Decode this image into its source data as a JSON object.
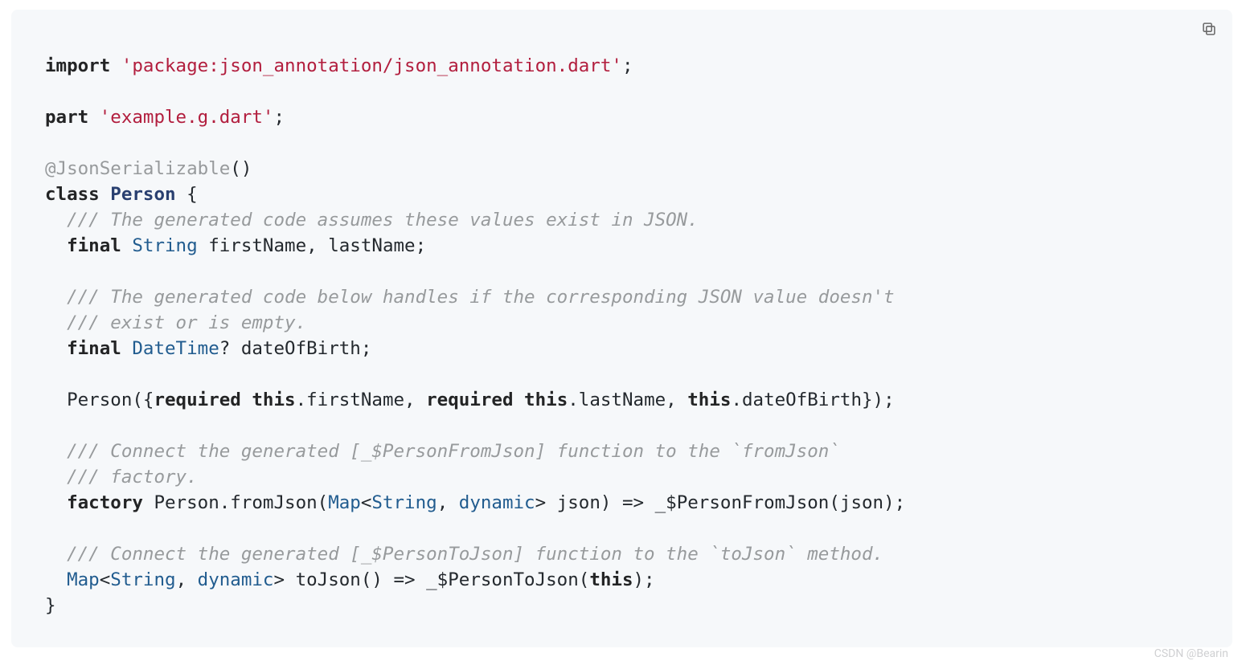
{
  "watermark": "CSDN @Bearin",
  "tokens": [
    [
      [
        "import ",
        "s-kw"
      ],
      [
        "'package:json_annotation/json_annotation.dart'",
        "s-str"
      ],
      [
        ";",
        ""
      ]
    ],
    [],
    [
      [
        "part ",
        "s-kw"
      ],
      [
        "'example.g.dart'",
        "s-str"
      ],
      [
        ";",
        ""
      ]
    ],
    [],
    [
      [
        "@JsonSerializable",
        "s-ann"
      ],
      [
        "()",
        ""
      ]
    ],
    [
      [
        "class ",
        "s-kw"
      ],
      [
        "Person",
        "s-cls"
      ],
      [
        " {",
        ""
      ]
    ],
    [
      [
        "  ",
        ""
      ],
      [
        "/// The generated code assumes these values exist in JSON.",
        "s-cmt"
      ]
    ],
    [
      [
        "  ",
        ""
      ],
      [
        "final ",
        "s-kw"
      ],
      [
        "String",
        "s-type"
      ],
      [
        " firstName, lastName;",
        ""
      ]
    ],
    [],
    [
      [
        "  ",
        ""
      ],
      [
        "/// The generated code below handles if the corresponding JSON value doesn't",
        "s-cmt"
      ]
    ],
    [
      [
        "  ",
        ""
      ],
      [
        "/// exist or is empty.",
        "s-cmt"
      ]
    ],
    [
      [
        "  ",
        ""
      ],
      [
        "final ",
        "s-kw"
      ],
      [
        "DateTime",
        "s-type"
      ],
      [
        "? dateOfBirth;",
        ""
      ]
    ],
    [],
    [
      [
        "  Person({",
        ""
      ],
      [
        "required this",
        "s-kw"
      ],
      [
        ".firstName, ",
        ""
      ],
      [
        "required this",
        "s-kw"
      ],
      [
        ".lastName, ",
        ""
      ],
      [
        "this",
        "s-kw"
      ],
      [
        ".dateOfBirth});",
        ""
      ]
    ],
    [],
    [
      [
        "  ",
        ""
      ],
      [
        "/// Connect the generated [_$PersonFromJson] function to the `fromJson`",
        "s-cmt"
      ]
    ],
    [
      [
        "  ",
        ""
      ],
      [
        "/// factory.",
        "s-cmt"
      ]
    ],
    [
      [
        "  ",
        ""
      ],
      [
        "factory",
        "s-kw"
      ],
      [
        " Person.fromJson(",
        ""
      ],
      [
        "Map",
        "s-type"
      ],
      [
        "<",
        ""
      ],
      [
        "String",
        "s-type"
      ],
      [
        ", ",
        ""
      ],
      [
        "dynamic",
        "s-type"
      ],
      [
        "> json) => _$PersonFromJson(json);",
        ""
      ]
    ],
    [],
    [
      [
        "  ",
        ""
      ],
      [
        "/// Connect the generated [_$PersonToJson] function to the `toJson` method.",
        "s-cmt"
      ]
    ],
    [
      [
        "  ",
        ""
      ],
      [
        "Map",
        "s-type"
      ],
      [
        "<",
        ""
      ],
      [
        "String",
        "s-type"
      ],
      [
        ", ",
        ""
      ],
      [
        "dynamic",
        "s-type"
      ],
      [
        "> toJson() => _$PersonToJson(",
        ""
      ],
      [
        "this",
        "s-kw"
      ],
      [
        ");",
        ""
      ]
    ],
    [
      [
        "}",
        ""
      ]
    ]
  ]
}
